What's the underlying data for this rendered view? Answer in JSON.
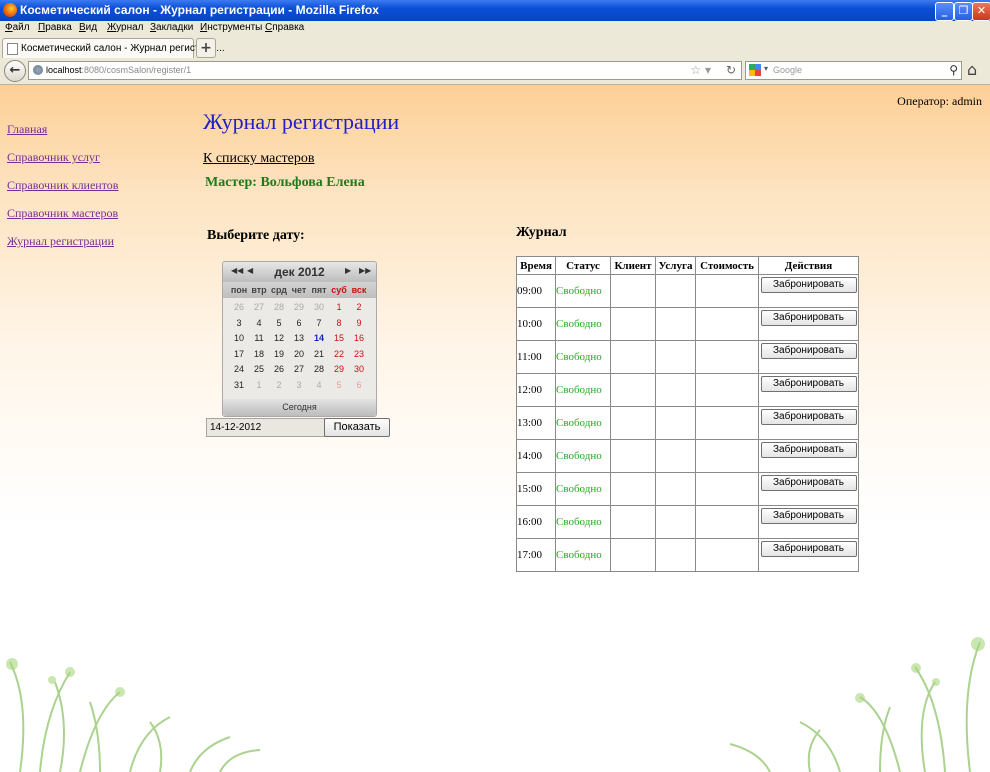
{
  "window": {
    "title": "Косметический салон - Журнал регистрации - Mozilla Firefox"
  },
  "menu": [
    "Файл",
    "Правка",
    "Вид",
    "Журнал",
    "Закладки",
    "Инструменты",
    "Справка"
  ],
  "tab": {
    "label": "Косметический салон - Журнал регистрац...",
    "new_tab": "+"
  },
  "address": {
    "host": "localhost",
    "rest": ":8080/cosmSalon/register/1"
  },
  "search": {
    "placeholder": "Google"
  },
  "operator": "Оператор: admin",
  "sidebar": [
    "Главная",
    "Справочник услуг",
    "Справочник клиентов",
    "Справочник мастеров",
    "Журнал регистрации"
  ],
  "heading": "Журнал регистрации",
  "back_link": "К списку мастеров",
  "master": "Мастер: Вольфова Елена",
  "choose_date": "Выберите дату:",
  "calendar": {
    "month": "дек 2012",
    "weekdays": [
      "пон",
      "втр",
      "срд",
      "чет",
      "пят",
      "суб",
      "вск"
    ],
    "weeks": [
      [
        "26",
        "27",
        "28",
        "29",
        "30",
        "1",
        "2"
      ],
      [
        "3",
        "4",
        "5",
        "6",
        "7",
        "8",
        "9"
      ],
      [
        "10",
        "11",
        "12",
        "13",
        "14",
        "15",
        "16"
      ],
      [
        "17",
        "18",
        "19",
        "20",
        "21",
        "22",
        "23"
      ],
      [
        "24",
        "25",
        "26",
        "27",
        "28",
        "29",
        "30"
      ],
      [
        "31",
        "1",
        "2",
        "3",
        "4",
        "5",
        "6"
      ]
    ],
    "selected": "14",
    "today_label": "Сегодня"
  },
  "date_field": "14-12-2012",
  "show_button": "Показать",
  "journal": {
    "title": "Журнал",
    "columns": [
      "Время",
      "Статус",
      "Клиент",
      "Услуга",
      "Стоимость",
      "Действия"
    ],
    "rows": [
      {
        "time": "09:00",
        "status": "Свободно",
        "client": "",
        "service": "",
        "cost": "",
        "action": "Забронировать"
      },
      {
        "time": "10:00",
        "status": "Свободно",
        "client": "",
        "service": "",
        "cost": "",
        "action": "Забронировать"
      },
      {
        "time": "11:00",
        "status": "Свободно",
        "client": "",
        "service": "",
        "cost": "",
        "action": "Забронировать"
      },
      {
        "time": "12:00",
        "status": "Свободно",
        "client": "",
        "service": "",
        "cost": "",
        "action": "Забронировать"
      },
      {
        "time": "13:00",
        "status": "Свободно",
        "client": "",
        "service": "",
        "cost": "",
        "action": "Забронировать"
      },
      {
        "time": "14:00",
        "status": "Свободно",
        "client": "",
        "service": "",
        "cost": "",
        "action": "Забронировать"
      },
      {
        "time": "15:00",
        "status": "Свободно",
        "client": "",
        "service": "",
        "cost": "",
        "action": "Забронировать"
      },
      {
        "time": "16:00",
        "status": "Свободно",
        "client": "",
        "service": "",
        "cost": "",
        "action": "Забронировать"
      },
      {
        "time": "17:00",
        "status": "Свободно",
        "client": "",
        "service": "",
        "cost": "",
        "action": "Забронировать"
      }
    ]
  },
  "colors": {
    "heading": "#2020c8",
    "master": "#1e7a1e",
    "status_free": "#22aa22",
    "link": "#7b2c95"
  }
}
